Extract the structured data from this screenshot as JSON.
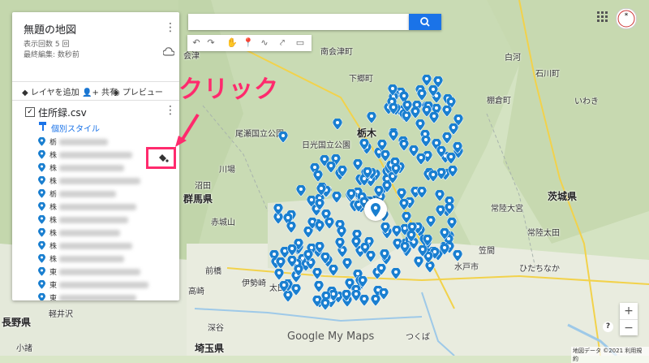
{
  "app": {
    "map_title": "無題の地図",
    "views": "表示回数 5 回",
    "last_edit": "最終編集: 数秒前"
  },
  "panel_actions": {
    "add_layer": "レイヤを追加",
    "share": "共有",
    "preview": "プレビュー"
  },
  "layer": {
    "name": "住所録.csv",
    "style_link": "個別スタイル",
    "items": [
      "栃",
      "株",
      "株",
      "株",
      "栃",
      "株",
      "株",
      "株",
      "株",
      "株",
      "東",
      "東",
      "東",
      "東"
    ]
  },
  "search": {
    "placeholder": ""
  },
  "annotation": {
    "text": "クリック",
    "color": "#ff2a6d"
  },
  "map_labels": {
    "aizu": "会津",
    "shimogo": "下郷町",
    "tajima": "南会津町",
    "shirakawa": "白河",
    "tanagura": "棚倉町",
    "ishikawa": "石川町",
    "iwaki": "いわき",
    "oze": "尾瀬国立公園",
    "nikko": "日光国立公園",
    "tochigi": "栃木",
    "hitachi_ohmiya": "常陸大宮",
    "ibaraki": "茨城県",
    "gunma": "群馬県",
    "akagi": "赤城山",
    "maebashi": "前橋",
    "takasaki": "高崎",
    "isesaki": "伊勢崎",
    "ota": "太田",
    "mito": "水戸市",
    "hitachinaka": "ひたちなか",
    "tsukuba": "つくば",
    "saitama": "埼玉県",
    "nagano": "長野県",
    "fukaya": "深谷",
    "karuizawa": "軽井沢",
    "komoro": "小諸",
    "kawaba": "川場",
    "numata": "沼田",
    "hitachi_ota": "常陸太田",
    "kasama": "笠間"
  },
  "footer": {
    "attribution": "地図データ ©2021  利用規約",
    "logo_text": "Google My Maps"
  },
  "controls": {
    "zoom_in": "+",
    "zoom_out": "−",
    "help": "?"
  },
  "colors": {
    "accent": "#1a73e8",
    "annotation": "#ff2a6d",
    "pin": "#1a7fd0"
  }
}
